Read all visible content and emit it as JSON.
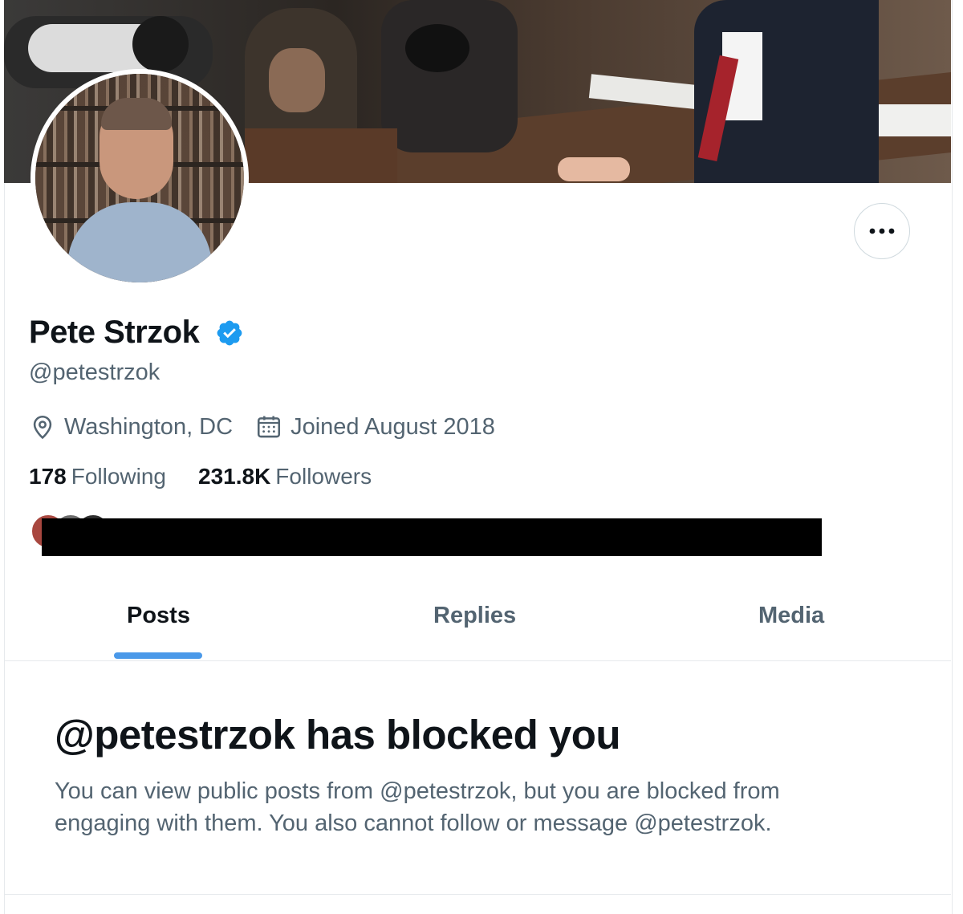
{
  "profile": {
    "display_name": "Pete Strzok",
    "handle": "@petestrzok",
    "location": "Washington, DC",
    "joined": "Joined August 2018",
    "following_count": "178",
    "following_label": "Following",
    "followers_count": "231.8K",
    "followers_label": "Followers",
    "verified": true
  },
  "icons": {
    "location": "location-pin-icon",
    "joined": "calendar-icon",
    "more": "more-horizontal-icon",
    "verified": "verified-badge-icon"
  },
  "tabs": [
    {
      "label": "Posts",
      "active": true
    },
    {
      "label": "Replies",
      "active": false
    },
    {
      "label": "Media",
      "active": false
    }
  ],
  "blocked_notice": {
    "title": "@petestrzok has blocked you",
    "message": "You can view public posts from @petestrzok, but you are blocked from engaging with them. You also cannot follow or message @petestrzok."
  },
  "colors": {
    "accent": "#4a99e9",
    "verified": "#1d9bf0",
    "text_primary": "#0f1419",
    "text_secondary": "#536471"
  }
}
